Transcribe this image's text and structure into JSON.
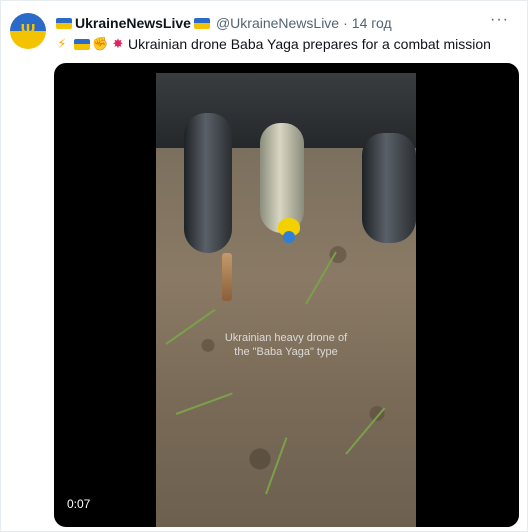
{
  "tweet": {
    "author_name": "UkraineNewsLive",
    "handle": "@UkraineNewsLive",
    "separator": "·",
    "time": "14 год",
    "more_label": "···",
    "text": "Ukrainian drone Baba Yaga prepares for a combat mission",
    "emojis": [
      "lightning-icon",
      "ukraine-flag-icon",
      "flexed-bicep-icon",
      "collision-icon"
    ]
  },
  "media": {
    "caption_line1": "Ukrainian heavy drone of",
    "caption_line2": "the \"Baba Yaga\" type",
    "timestamp": "0:07"
  },
  "colors": {
    "flag_blue": "#2a6ac9",
    "flag_yellow": "#f3c300",
    "secondary_text": "#536471"
  }
}
